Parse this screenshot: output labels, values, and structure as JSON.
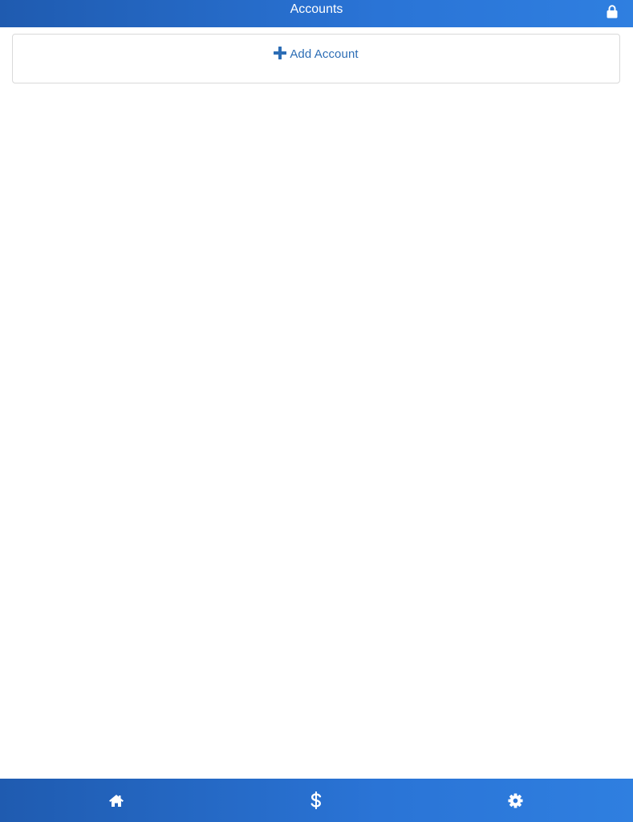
{
  "header": {
    "title": "Accounts",
    "lock_icon": "lock-icon"
  },
  "main": {
    "add_account": {
      "icon": "plus-icon",
      "label": "Add Account"
    }
  },
  "tabbar": {
    "tabs": [
      {
        "icon": "home-icon"
      },
      {
        "icon": "dollar-icon"
      },
      {
        "icon": "gear-icon"
      }
    ]
  },
  "colors": {
    "header_gradient_start": "#1f5bb0",
    "header_gradient_end": "#2f7fe0",
    "accent_text": "#2c6db5",
    "card_border": "#d9d9d9"
  }
}
